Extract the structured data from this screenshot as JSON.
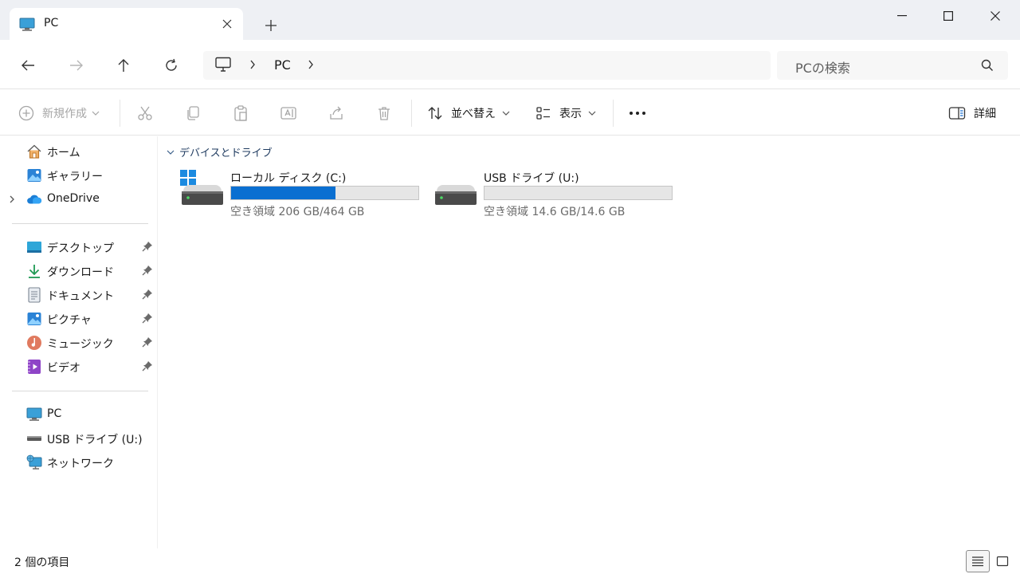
{
  "tab": {
    "title": "PC"
  },
  "address": {
    "location": "PC"
  },
  "search": {
    "placeholder": "PCの検索"
  },
  "commands": {
    "new": "新規作成",
    "sort": "並べ替え",
    "view": "表示",
    "details": "詳細"
  },
  "sidebar": {
    "home": "ホーム",
    "gallery": "ギャラリー",
    "onedrive": "OneDrive",
    "desktop": "デスクトップ",
    "downloads": "ダウンロード",
    "documents": "ドキュメント",
    "pictures": "ピクチャ",
    "music": "ミュージック",
    "videos": "ビデオ",
    "pc": "PC",
    "usb": "USB ドライブ (U:)",
    "network": "ネットワーク"
  },
  "section": {
    "title": "デバイスとドライブ"
  },
  "drives": [
    {
      "name": "ローカル ディスク (C:)",
      "free_text": "空き領域 206 GB/464 GB",
      "used_fraction": 0.556
    },
    {
      "name": "USB ドライブ (U:)",
      "free_text": "空き領域 14.6 GB/14.6 GB",
      "used_fraction": 0.0
    }
  ],
  "status": {
    "item_count": "2 個の項目"
  },
  "colors": {
    "accent": "#0a6fd1",
    "titlebar": "#eef0f4"
  }
}
